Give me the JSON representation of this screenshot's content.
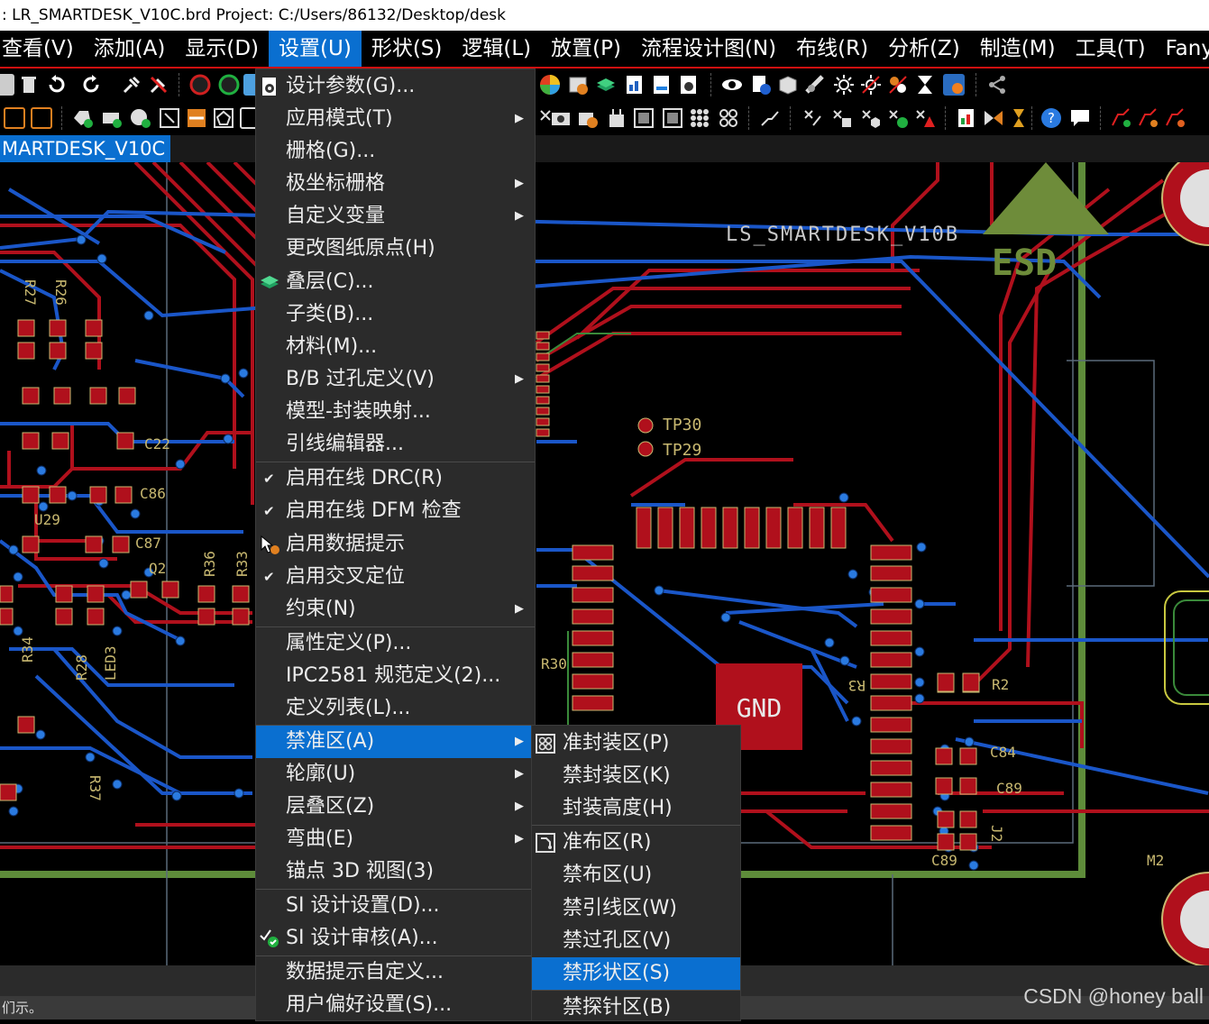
{
  "title": {
    "text": ": LR_SMARTDESK_V10C.brd  Project: C:/Users/86132/Desktop/desk"
  },
  "menubar": {
    "items": [
      "查看(V)",
      "添加(A)",
      "显示(D)",
      "设置(U)",
      "形状(S)",
      "逻辑(L)",
      "放置(P)",
      "流程设计图(N)",
      "布线(R)",
      "分析(Z)",
      "制造(M)",
      "工具(T)",
      "FanySkill"
    ]
  },
  "tab": {
    "label": "MARTDESK_V10C"
  },
  "pcb": {
    "silk_board_name": "LS_SMARTDESK_V10B",
    "esd": "ESD",
    "gnd": "GND",
    "tp30": "TP30",
    "tp29": "TP29",
    "refs": [
      "R27",
      "R26",
      "C22",
      "C86",
      "U29",
      "C87",
      "Q2",
      "R36",
      "R33",
      "R34",
      "R28",
      "LED3",
      "R37",
      "R30",
      "C84",
      "C89",
      "C89",
      "R2",
      "M2",
      "J2",
      "R3"
    ]
  },
  "setup_menu": {
    "items": [
      {
        "label": "设计参数(G)..."
      },
      {
        "label": "应用模式(T)",
        "submenu": true
      },
      {
        "label": "栅格(G)..."
      },
      {
        "label": "极坐标栅格",
        "submenu": true
      },
      {
        "label": "自定义变量",
        "submenu": true
      },
      {
        "label": "更改图纸原点(H)"
      },
      {
        "label": "叠层(C)..."
      },
      {
        "label": "子类(B)..."
      },
      {
        "label": "材料(M)..."
      },
      {
        "label": "B/B 过孔定义(V)",
        "submenu": true
      },
      {
        "label": "模型-封装映射..."
      },
      {
        "label": "引线编辑器..."
      },
      {
        "label": "启用在线 DRC(R)",
        "checked": true
      },
      {
        "label": "启用在线 DFM 检查",
        "checked": true
      },
      {
        "label": "启用数据提示"
      },
      {
        "label": "启用交叉定位",
        "checked": true
      },
      {
        "label": "约束(N)",
        "submenu": true
      },
      {
        "label": "属性定义(P)..."
      },
      {
        "label": "IPC2581 规范定义(2)..."
      },
      {
        "label": "定义列表(L)..."
      },
      {
        "label": "禁准区(A)",
        "submenu": true,
        "highlighted": true
      },
      {
        "label": "轮廓(U)",
        "submenu": true
      },
      {
        "label": "层叠区(Z)",
        "submenu": true
      },
      {
        "label": "弯曲(E)",
        "submenu": true
      },
      {
        "label": "锚点 3D 视图(3)"
      },
      {
        "label": "SI 设计设置(D)..."
      },
      {
        "label": "SI 设计审核(A)..."
      },
      {
        "label": "数据提示自定义..."
      },
      {
        "label": "用户偏好设置(S)..."
      }
    ]
  },
  "keepin_submenu": {
    "items": [
      {
        "label": "准封装区(P)"
      },
      {
        "label": "禁封装区(K)"
      },
      {
        "label": "封装高度(H)"
      },
      {
        "label": "准布区(R)"
      },
      {
        "label": "禁布区(U)"
      },
      {
        "label": "禁引线区(W)"
      },
      {
        "label": "禁过孔区(V)"
      },
      {
        "label": "禁形状区(S)",
        "highlighted": true
      },
      {
        "label": "禁探针区(B)"
      }
    ]
  },
  "status": {
    "text": "们示。"
  },
  "watermark": {
    "text": "CSDN @honey ball"
  },
  "colors": {
    "accent": "#0a6fd0",
    "copper_red": "#b0101c",
    "trace_blue": "#1a56c8",
    "outline_green": "#5e8c3a",
    "menu_bg": "#2b2b2b"
  }
}
